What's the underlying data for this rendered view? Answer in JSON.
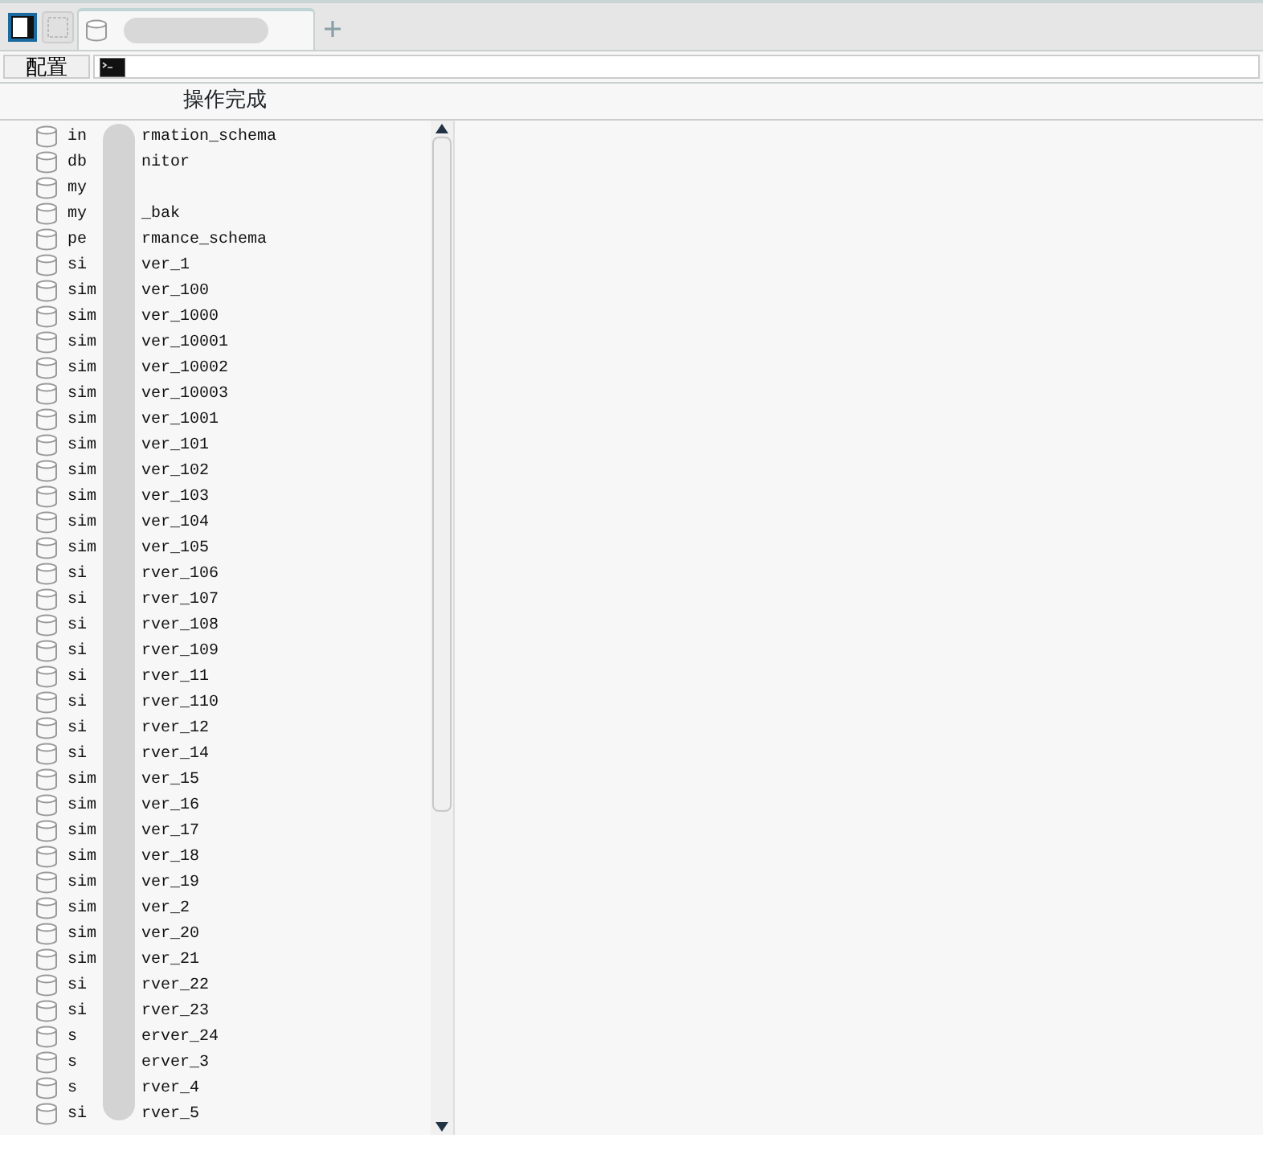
{
  "tabs": [
    {
      "kind": "database",
      "selected": true
    }
  ],
  "toolbar": {
    "config_button": "配置"
  },
  "status": "操作完成",
  "databases": [
    {
      "start": "in",
      "end": "rmation_schema"
    },
    {
      "start": "db",
      "end": "nitor"
    },
    {
      "start": "my"
    },
    {
      "start": "my",
      "end": "_bak"
    },
    {
      "start": "pe",
      "end": "rmance_schema"
    },
    {
      "start": "si",
      "end": "ver_1"
    },
    {
      "start": "sim",
      "end": "ver_100"
    },
    {
      "start": "sim",
      "end": "ver_1000"
    },
    {
      "start": "sim",
      "end": "ver_10001"
    },
    {
      "start": "sim",
      "end": "ver_10002"
    },
    {
      "start": "sim",
      "end": "ver_10003"
    },
    {
      "start": "sim",
      "end": "ver_1001"
    },
    {
      "start": "sim",
      "end": "ver_101"
    },
    {
      "start": "sim",
      "end": "ver_102"
    },
    {
      "start": "sim",
      "end": "ver_103"
    },
    {
      "start": "sim",
      "end": "ver_104"
    },
    {
      "start": "sim",
      "end": "ver_105"
    },
    {
      "start": "si",
      "end": "rver_106"
    },
    {
      "start": "si",
      "end": "rver_107"
    },
    {
      "start": "si",
      "end": "rver_108"
    },
    {
      "start": "si",
      "end": "rver_109"
    },
    {
      "start": "si",
      "end": "rver_11"
    },
    {
      "start": "si",
      "end": "rver_110"
    },
    {
      "start": "si",
      "end": "rver_12"
    },
    {
      "start": "si",
      "end": "rver_14"
    },
    {
      "start": "sim",
      "end": "ver_15"
    },
    {
      "start": "sim",
      "end": "ver_16"
    },
    {
      "start": "sim",
      "end": "ver_17"
    },
    {
      "start": "sim",
      "end": "ver_18"
    },
    {
      "start": "sim",
      "end": "ver_19"
    },
    {
      "start": "sim",
      "end": "ver_2"
    },
    {
      "start": "sim",
      "end": "ver_20"
    },
    {
      "start": "sim",
      "end": "ver_21"
    },
    {
      "start": "si",
      "end": "rver_22"
    },
    {
      "start": "si",
      "end": "rver_23"
    },
    {
      "start": "s",
      "end": "erver_24"
    },
    {
      "start": "s",
      "end": "erver_3"
    },
    {
      "start": "s",
      "end": "rver_4"
    },
    {
      "start": "si",
      "end": "rver_5"
    }
  ]
}
